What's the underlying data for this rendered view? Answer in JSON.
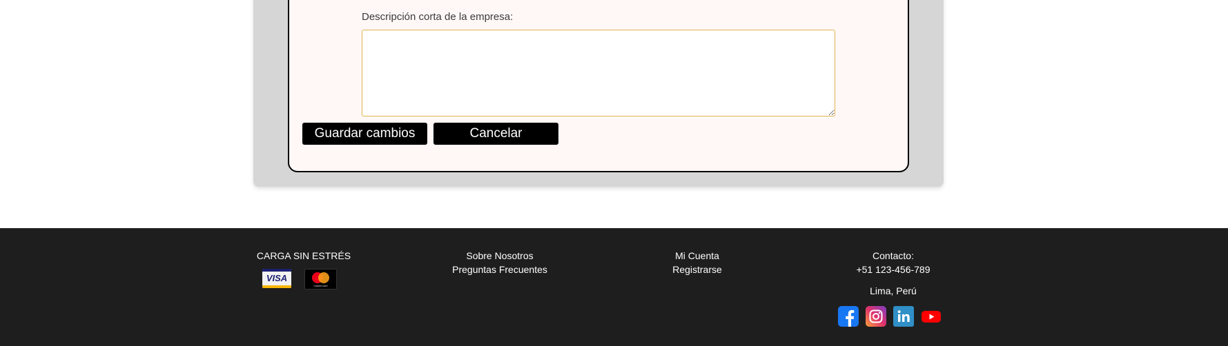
{
  "form": {
    "description_label": "Descripción corta de la empresa:",
    "description_value": "",
    "save_button": "Guardar cambios",
    "cancel_button": "Cancelar"
  },
  "footer": {
    "brand": "CARGA SIN ESTRÉS",
    "payment_icons": [
      "visa-icon",
      "mastercard-icon"
    ],
    "visa_text": "VISA",
    "mastercard_text": "mastercard",
    "about_links": [
      "Sobre Nosotros",
      "Preguntas Frecuentes"
    ],
    "account_links": [
      "Mi Cuenta",
      "Registrarse"
    ],
    "contact_label": "Contacto:",
    "phone": "+51 123-456-789",
    "location": "Lima, Perú",
    "social_icons": [
      "facebook-icon",
      "instagram-icon",
      "linkedin-icon",
      "youtube-icon"
    ]
  },
  "colors": {
    "footer_bg": "#1f1e1e",
    "card_bg": "#fff8f7",
    "panel_bg": "#d6d6d6",
    "textarea_border": "#e0b24a",
    "button_bg": "#000000"
  }
}
